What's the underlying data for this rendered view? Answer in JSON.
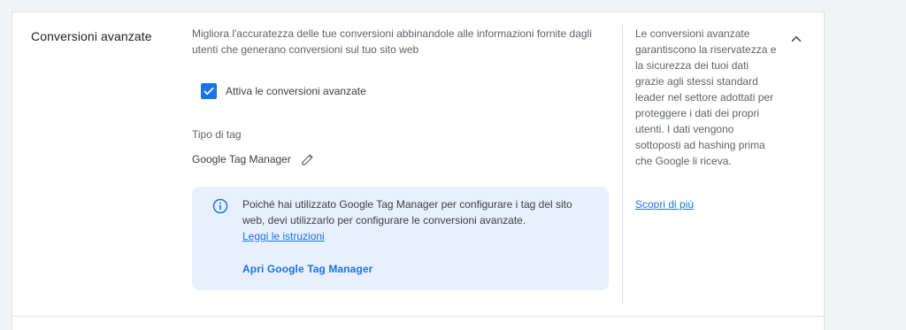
{
  "section": {
    "title": "Conversioni avanzate",
    "description": "Migliora l'accuratezza delle tue conversioni abbinandole alle informazioni fornite dagli utenti che generano conversioni sul tuo sito web"
  },
  "checkbox": {
    "label": "Attiva le conversioni avanzate",
    "checked": true,
    "color": "#1a73e8"
  },
  "tag": {
    "label": "Tipo di tag",
    "value": "Google Tag Manager",
    "edit_icon": "pencil-icon"
  },
  "info": {
    "icon": "info-icon",
    "text": "Poiché hai utilizzato Google Tag Manager per configurare i tag del sito web, devi utilizzarlo per configurare le conversioni avanzate.",
    "link": "Leggi le istruzioni",
    "button": "Apri Google Tag Manager",
    "background": "#e8f0fe"
  },
  "side": {
    "text": "Le conversioni avanzate garantiscono la riservatezza e la sicurezza dei tuoi dati grazie agli stessi standard leader nel settore adottati per proteggere i dati dei propri utenti. I dati vengono sottoposti ad hashing prima che Google li riceva.",
    "link": "Scopri di più"
  },
  "collapse_icon": "chevron-up-icon"
}
